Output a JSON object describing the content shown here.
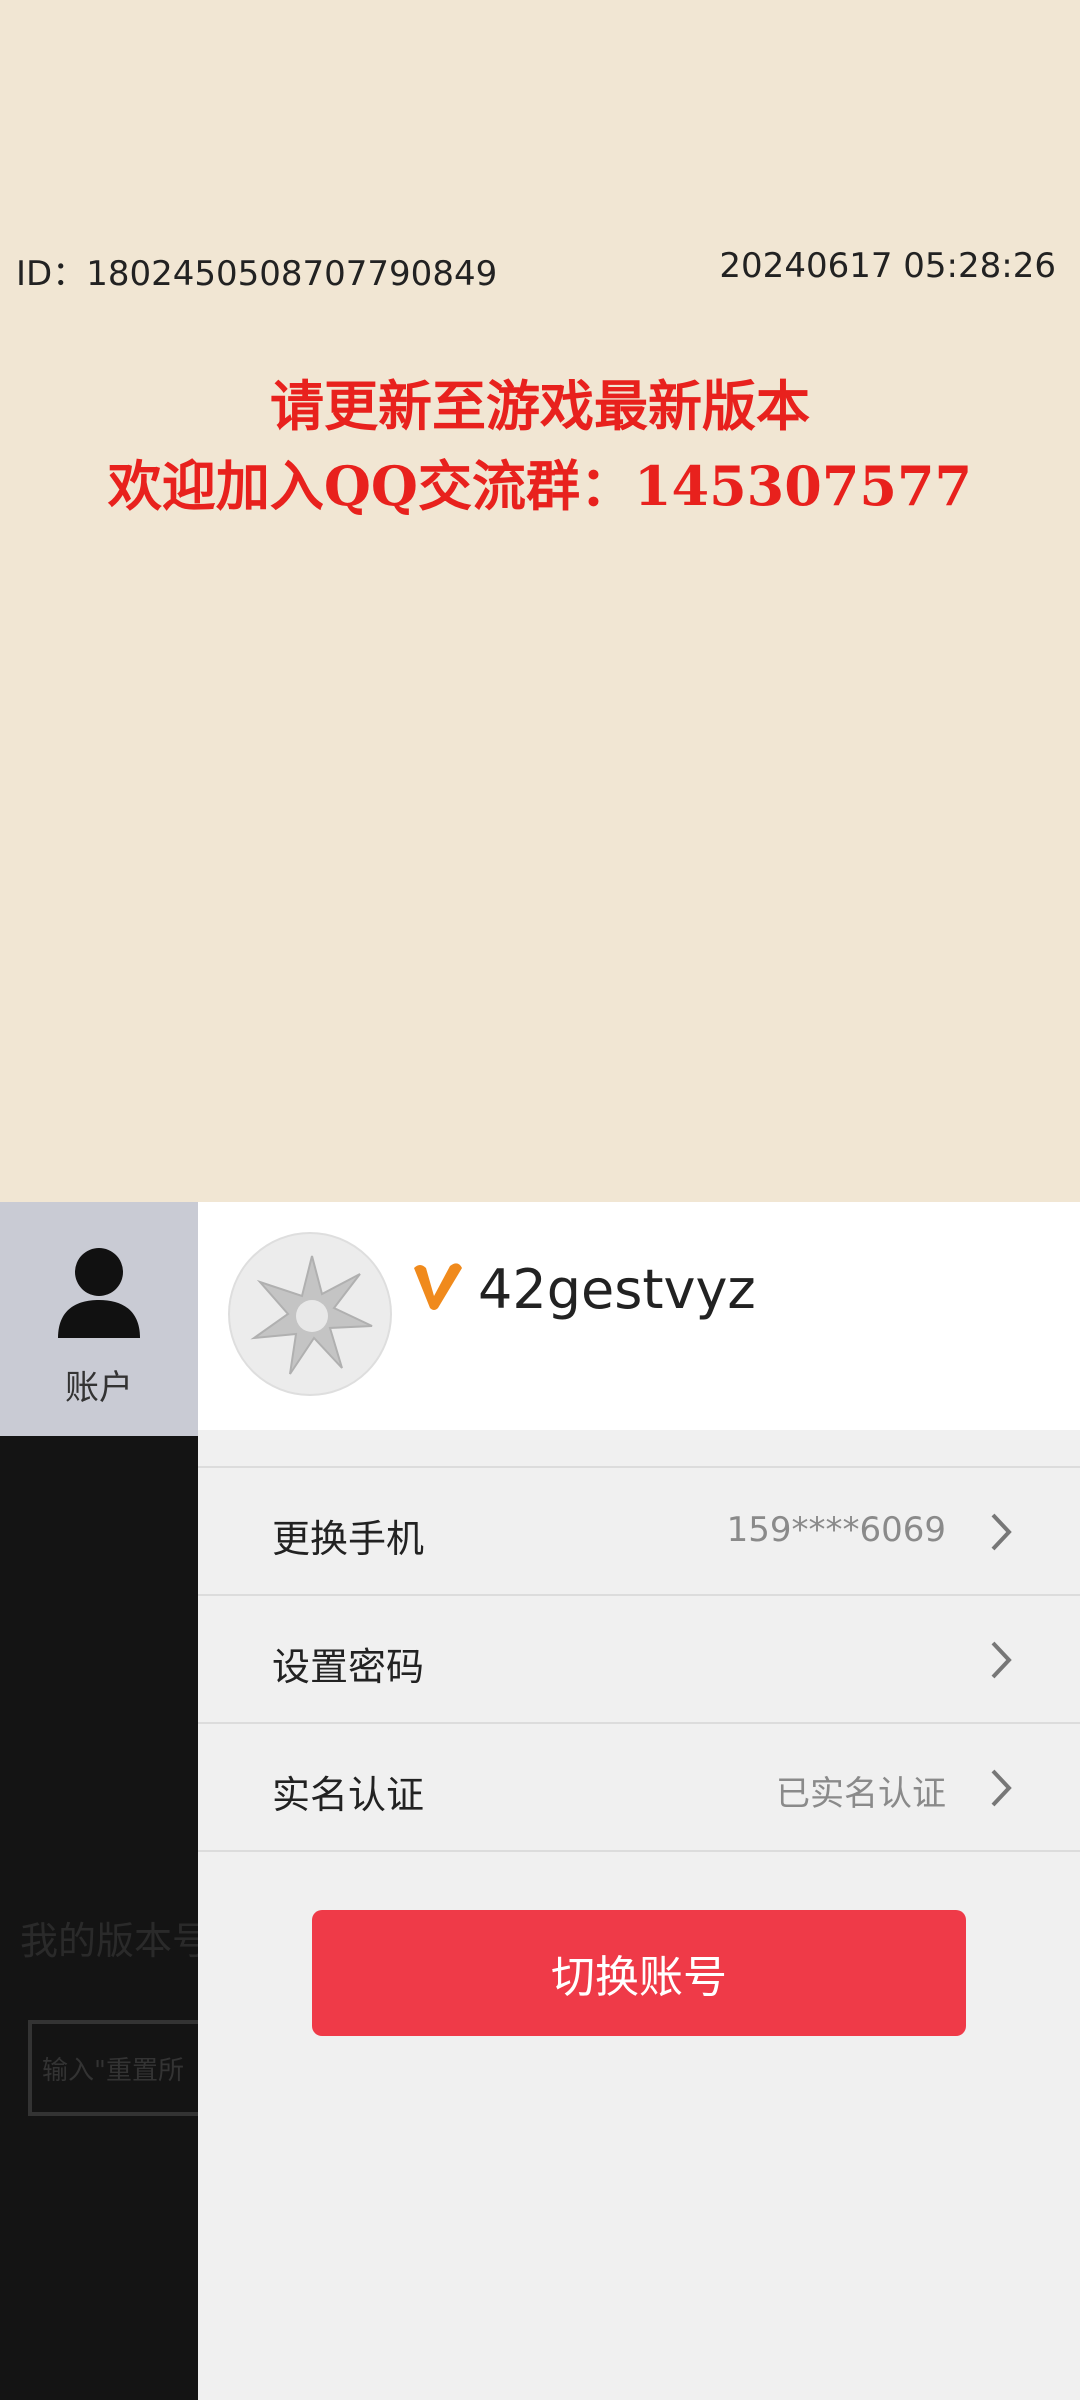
{
  "game": {
    "id_text": "ID：1802450508707790849",
    "timestamp": "20240617  05:28:26",
    "notice_line1": "请更新至游戏最新版本",
    "notice_line2": "欢迎加入QQ交流群：145307577",
    "bg_version_text": "我的版本号",
    "bg_input_placeholder": "输入\"重置所"
  },
  "nav": {
    "account_label": "账户",
    "account_icon": "person-icon"
  },
  "profile": {
    "vip_icon": "v-badge-icon",
    "username": "42gestvyz"
  },
  "settings": [
    {
      "label": "更换手机",
      "value": "159****6069"
    },
    {
      "label": "设置密码",
      "value": ""
    },
    {
      "label": "实名认证",
      "value": "已实名认证"
    }
  ],
  "switch_account_label": "切换账号",
  "colors": {
    "background": "#f1e6d3",
    "notice_red": "#e8211d",
    "button_red": "#ef3a48",
    "nav_active": "#c9cbd4"
  }
}
